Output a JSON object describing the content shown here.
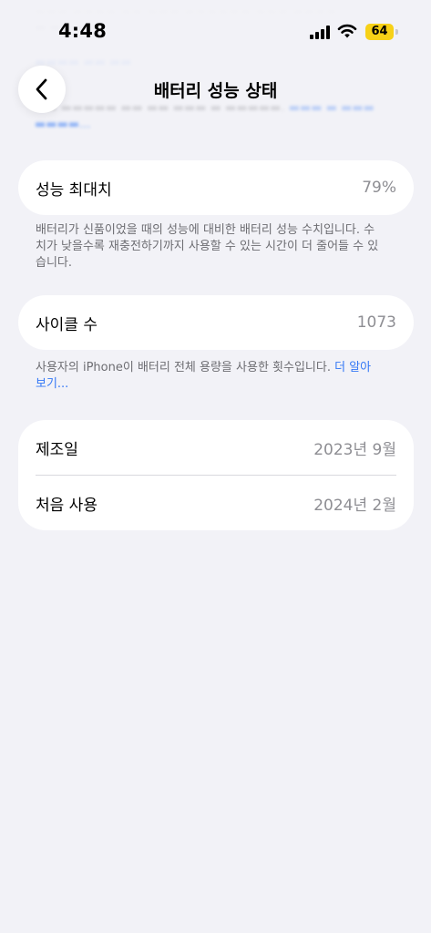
{
  "status_bar": {
    "time": "4:48",
    "battery_level": "64",
    "battery_color": "#f7d117"
  },
  "nav": {
    "title": "배터리 성능 상태",
    "back_icon": "chevron-left-icon"
  },
  "performance": {
    "label": "성능 최대치",
    "value": "79%",
    "note": "배터리가 신품이었을 때의 성능에 대비한 배터리 성능 수치입니다. 수치가 낮을수록 재충전하기까지 사용할 수 있는 시간이 더 줄어들 수 있습니다."
  },
  "cycle": {
    "label": "사이클 수",
    "value": "1073",
    "note": "사용자의 iPhone이 배터리 전체 용량을 사용한 횟수입니다. ",
    "link": "더 알아보기..."
  },
  "dates": {
    "manufacture_label": "제조일",
    "manufacture_value": "2023년 9월",
    "first_use_label": "처음 사용",
    "first_use_value": "2024년 2월"
  },
  "colors": {
    "accent": "#3478f6",
    "background": "#f2f2f7"
  }
}
